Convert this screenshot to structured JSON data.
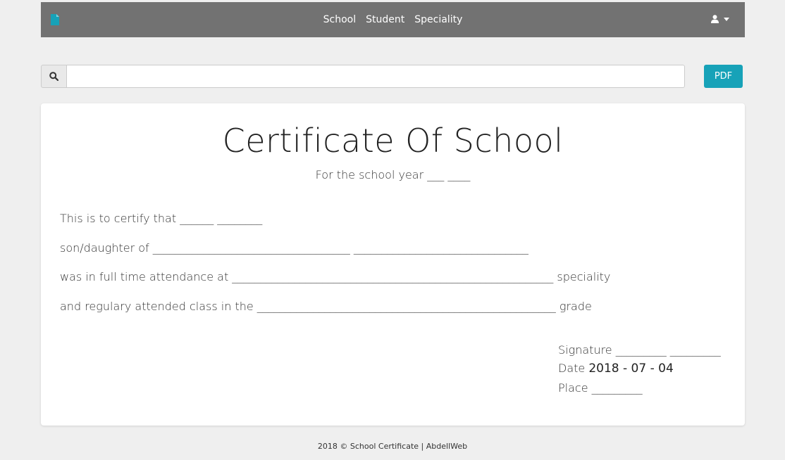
{
  "navbar": {
    "logo_icon": "file-icon",
    "links": [
      "School",
      "Student",
      "Speciality"
    ],
    "user_icon": "user-icon",
    "accent_color": "#17a2b8",
    "background_color": "#727272"
  },
  "search": {
    "icon": "search-icon",
    "value": "",
    "placeholder": ""
  },
  "toolbar": {
    "pdf_label": "PDF"
  },
  "certificate": {
    "title": "Certificate Of School",
    "subtitle": "For the school year ___ ____",
    "lines": [
      "This is to certify that ______ ________",
      "son/daughter of ___________________________________ _______________________________",
      "was in full time attendance at _________________________________________________________ speciality",
      "and regulary attended class in the _____________________________________________________ grade"
    ],
    "signature_label": "Signature _________ _________",
    "date_label": "Date",
    "date_value": "2018 - 07 - 04",
    "place_label": "Place _________"
  },
  "footer": {
    "text": "2018 © School Certificate | AbdellWeb"
  }
}
